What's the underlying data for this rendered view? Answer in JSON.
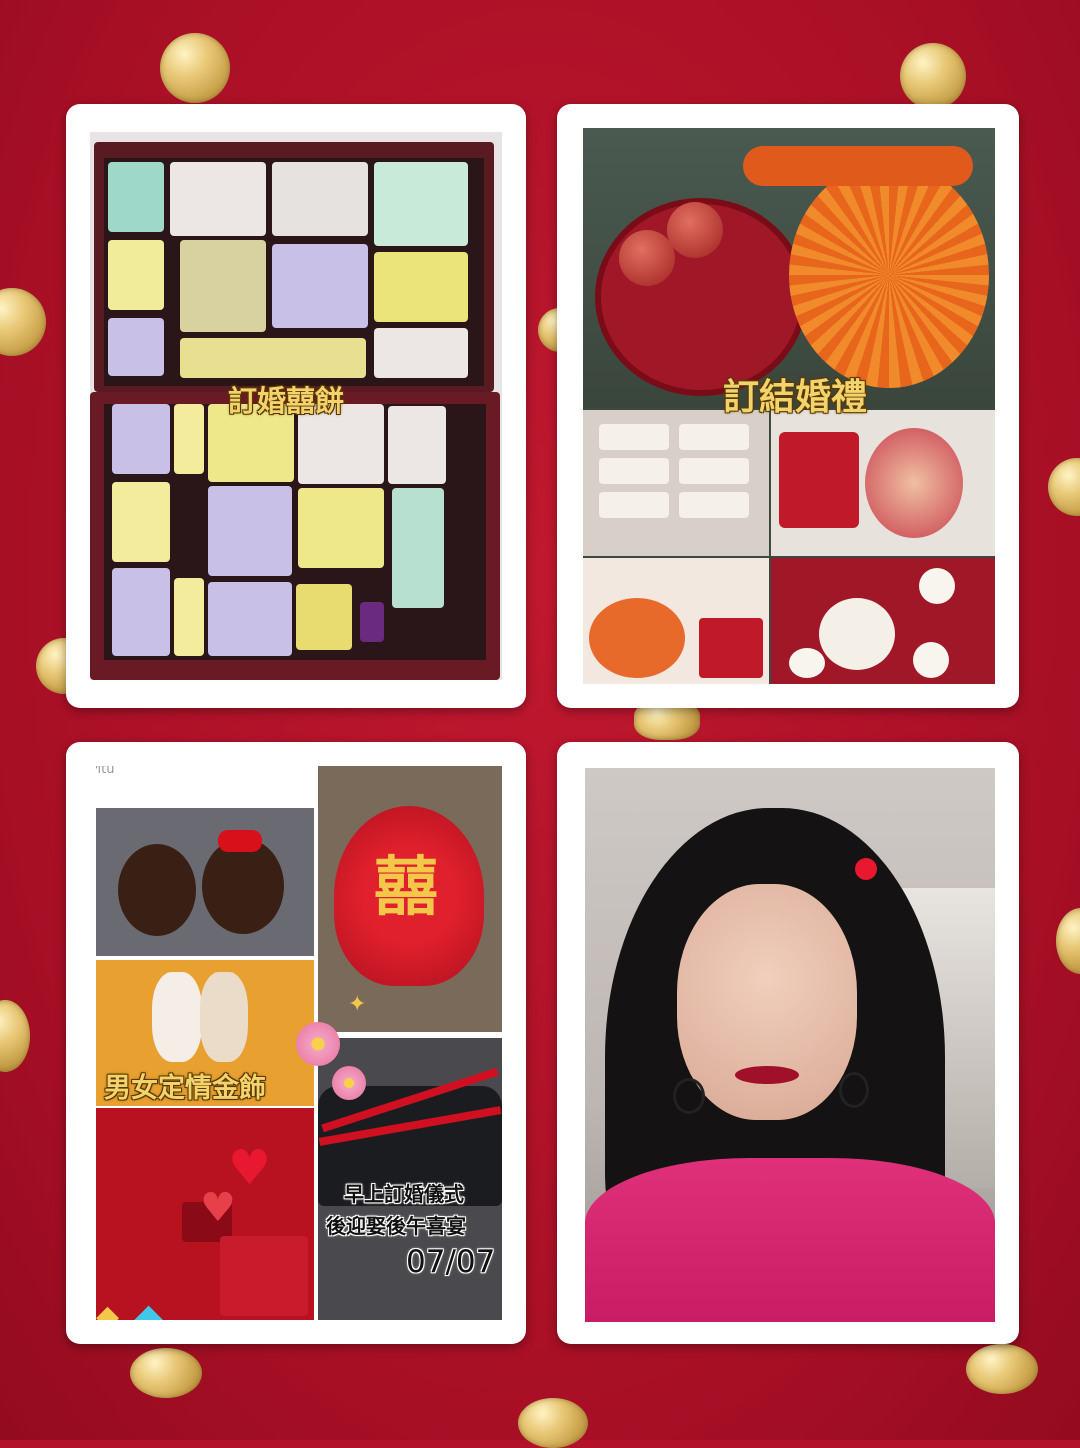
{
  "background_color": "#b3122b",
  "accent_gold": "#e8c877",
  "panels": {
    "cookies": {
      "caption": "訂婚囍餅"
    },
    "gifts": {
      "caption": "訂結婚禮"
    },
    "collage": {
      "watermark": "ePitu",
      "jewelry_caption": "男女定情金飾",
      "schedule_line1": "早上訂婚儀式",
      "schedule_line2": "後迎娶後午喜宴",
      "date": "07/07"
    },
    "portrait": {}
  },
  "decor": {
    "double_happiness": "囍"
  }
}
